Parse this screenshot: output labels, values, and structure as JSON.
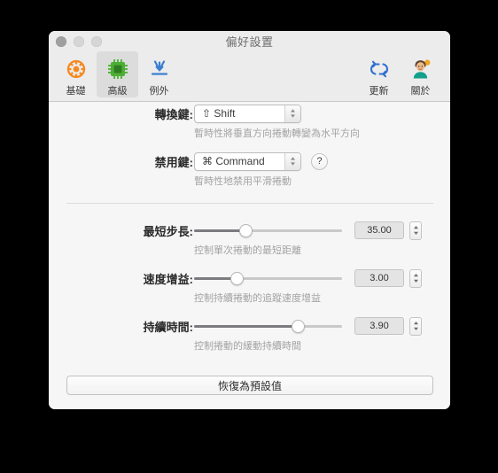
{
  "window": {
    "title": "偏好設置",
    "traffic_lights": [
      "close",
      "minimize",
      "zoom"
    ]
  },
  "toolbar": {
    "left_items": [
      {
        "label": "基礎",
        "icon": "gear-icon",
        "selected": false,
        "color": "#f5891f"
      },
      {
        "label": "高級",
        "icon": "cpu-chip-icon",
        "selected": true,
        "color": "#4caf34"
      },
      {
        "label": "例外",
        "icon": "download-inbox-icon",
        "selected": false,
        "color": "#3d7fd0"
      }
    ],
    "right_items": [
      {
        "label": "更新",
        "icon": "refresh-sync-icon",
        "color": "#2f6fd0"
      },
      {
        "label": "關於",
        "icon": "person-avatar-icon",
        "color": "#16a085"
      }
    ]
  },
  "form": {
    "modifier_rows": [
      {
        "label": "轉換鍵:",
        "value": "⇧ Shift",
        "helper": "暫時性將垂直方向捲動轉變為水平方向",
        "has_help": false
      },
      {
        "label": "禁用鍵:",
        "value": "⌘ Command",
        "helper": "暫時性地禁用平滑捲動",
        "has_help": true,
        "help_label": "?"
      }
    ],
    "slider_rows": [
      {
        "label": "最短步長:",
        "value": "35.00",
        "helper": "控制單次捲動的最短距離",
        "percent": 35
      },
      {
        "label": "速度增益:",
        "value": "3.00",
        "helper": "控制持續捲動的追蹤速度增益",
        "percent": 29
      },
      {
        "label": "持續時間:",
        "value": "3.90",
        "helper": "控制捲動的緩動持續時間",
        "percent": 70
      }
    ],
    "reset_button": "恢復為預設值"
  }
}
